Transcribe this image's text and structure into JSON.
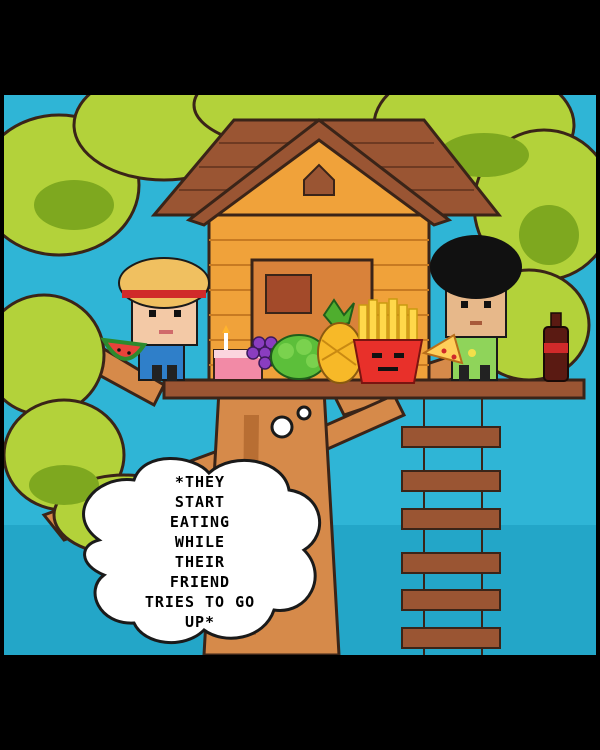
{
  "panel": {
    "caption_lines": [
      "*THEY",
      "START",
      "EATiNG",
      "WHiLE",
      "THEiR",
      "FRiEND",
      "TRiES TO GO",
      "UP*"
    ]
  },
  "colors": {
    "sky": "#2fb5d6",
    "foliage": "#b3d23a",
    "foliage_dark": "#7ea81f",
    "trunk": "#d68a4a",
    "house_orange": "#f0a23a",
    "roof_brown": "#9a5533",
    "outline": "#3a2418"
  },
  "icons": [
    "watermelon-slice-icon",
    "birthday-cake-icon",
    "grapes-icon",
    "broccoli-icon",
    "pineapple-icon",
    "french-fries-icon",
    "pizza-slice-icon",
    "cola-bottle-icon"
  ]
}
